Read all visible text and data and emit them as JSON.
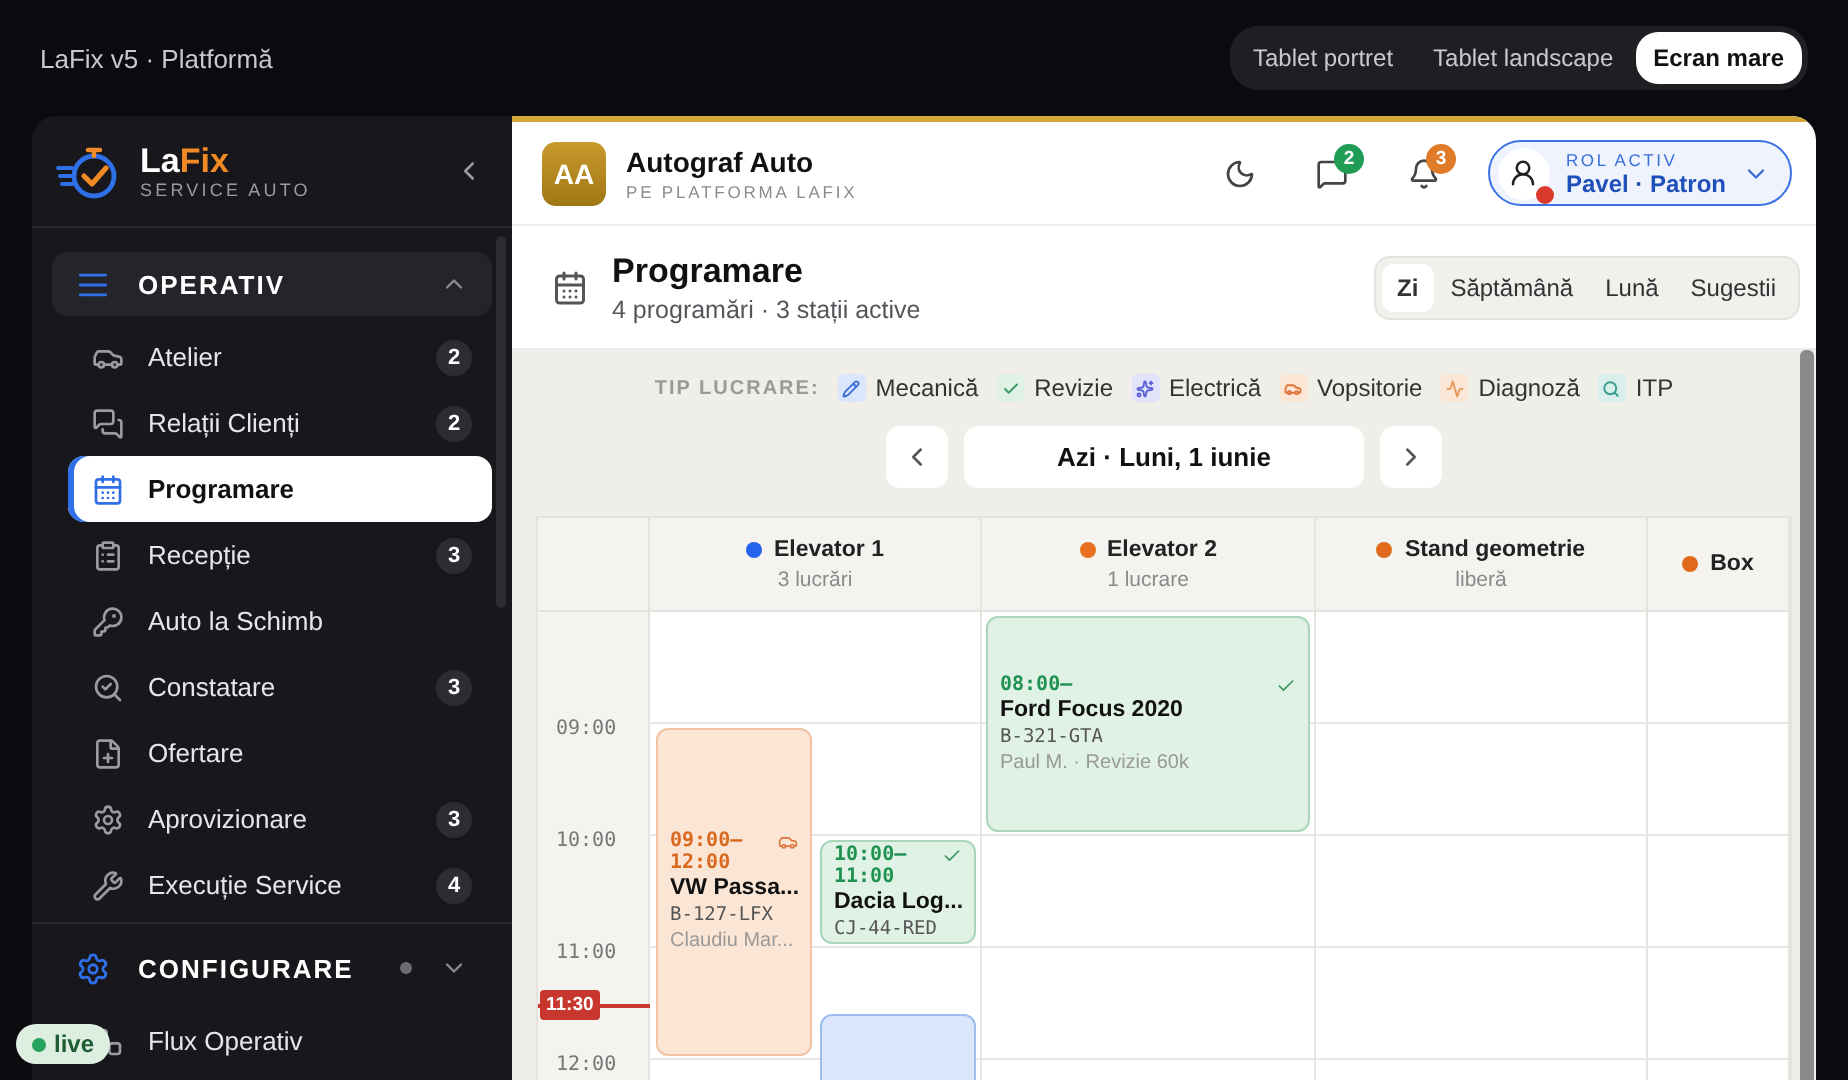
{
  "app_bar": {
    "title": "LaFix v5 · Platformă",
    "views": [
      {
        "label": "Tablet portret",
        "selected": false
      },
      {
        "label": "Tablet landscape",
        "selected": false
      },
      {
        "label": "Ecran mare",
        "selected": true
      }
    ]
  },
  "sidebar": {
    "brand": {
      "name_start": "La",
      "name_accent": "Fix",
      "tagline": "SERVICE AUTO"
    },
    "sections": [
      {
        "title": "OPERATIV",
        "kind": "operativ",
        "expanded": true,
        "items": [
          {
            "label": "Atelier",
            "badge": "2",
            "selected": false
          },
          {
            "label": "Relații Clienți",
            "badge": "2",
            "selected": false
          },
          {
            "label": "Programare",
            "selected": true
          },
          {
            "label": "Recepție",
            "badge": "3",
            "selected": false
          },
          {
            "label": "Auto la Schimb",
            "selected": false
          },
          {
            "label": "Constatare",
            "badge": "3",
            "selected": false
          },
          {
            "label": "Ofertare",
            "selected": false
          },
          {
            "label": "Aprovizionare",
            "badge": "3",
            "selected": false
          },
          {
            "label": "Execuție Service",
            "badge": "4",
            "selected": false
          }
        ]
      },
      {
        "title": "CONFIGURARE",
        "kind": "configurare",
        "expanded": false,
        "items": [
          {
            "label": "Flux Operativ",
            "selected": false
          }
        ]
      }
    ]
  },
  "live_badge": {
    "label": "live"
  },
  "workshop": {
    "initials": "AA",
    "name": "Autograf Auto",
    "subtitle": "PE PLATFORMA LAFIX"
  },
  "notifications": [
    {
      "kind": "messages",
      "count": "2",
      "color": "#1f9d55"
    },
    {
      "kind": "alerts",
      "count": "3",
      "color": "#e07b2a"
    }
  ],
  "role": {
    "label": "ROL ACTIV",
    "name": "Pavel · Patron"
  },
  "page": {
    "title": "Programare",
    "subtitle": "4 programări · 3 stații active",
    "views": [
      {
        "label": "Zi",
        "selected": true
      },
      {
        "label": "Săptămână",
        "selected": false
      },
      {
        "label": "Lună",
        "selected": false
      },
      {
        "label": "Sugestii",
        "selected": false
      }
    ]
  },
  "legend": {
    "label": "TIP LUCRARE:",
    "types": [
      {
        "kind": "mecanica",
        "label": "Mecanică"
      },
      {
        "kind": "revizie",
        "label": "Revizie"
      },
      {
        "kind": "electrica",
        "label": "Electrică"
      },
      {
        "kind": "vopsitorie",
        "label": "Vopsitorie"
      },
      {
        "kind": "diagnoza",
        "label": "Diagnoză"
      },
      {
        "kind": "itp",
        "label": "ITP"
      }
    ]
  },
  "date_nav": {
    "label": "Azi · Luni, 1 iunie"
  },
  "calendar": {
    "hours": [
      "09:00",
      "10:00",
      "11:00",
      "12:00"
    ],
    "now": "11:30",
    "stations": [
      {
        "name": "Elevator 1",
        "status": "3 lucrări",
        "color": "#2563eb",
        "events": [
          {
            "kind": "vopsitorie",
            "time": "09:00–12:00",
            "title": "VW Passa...",
            "plate": "B-127-LFX",
            "info": "Claudiu Mar..."
          },
          {
            "kind": "revizie",
            "time": "10:00–11:00",
            "title": "Dacia Log...",
            "plate": "CJ-44-RED"
          },
          {
            "kind": "mecanica"
          }
        ]
      },
      {
        "name": "Elevator 2",
        "status": "1 lucrare",
        "color": "#e8701f",
        "events": [
          {
            "kind": "revizie",
            "time": "08:00–",
            "title": "Ford Focus 2020",
            "plate": "B-321-GTA",
            "info": "Paul M. · Revizie 60k"
          }
        ]
      },
      {
        "name": "Stand geometrie",
        "status": "liberă",
        "color": "#e06a1b"
      },
      {
        "name": "Box",
        "color": "#e06a1b"
      }
    ]
  }
}
